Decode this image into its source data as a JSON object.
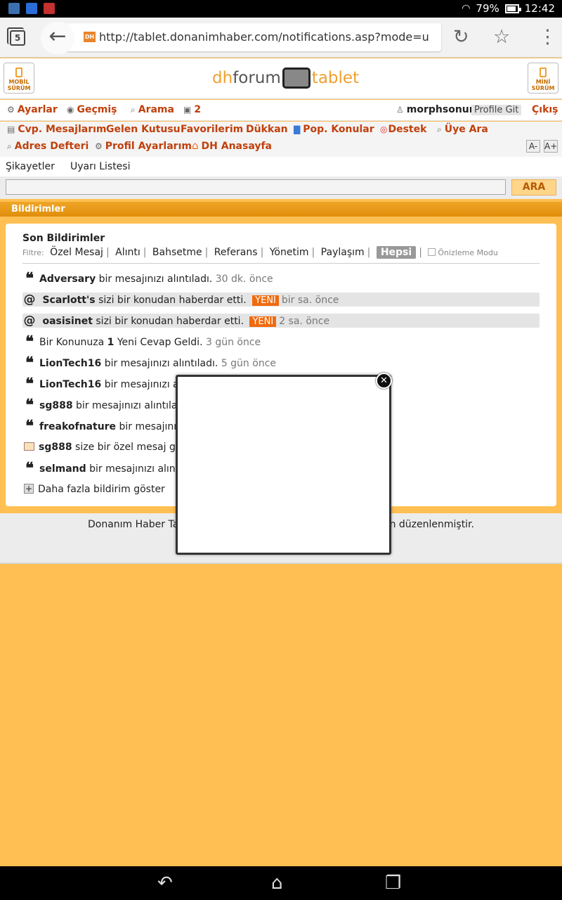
{
  "status_bar": {
    "battery": "79%",
    "time": "12:42"
  },
  "browser": {
    "tab_count": "5",
    "favicon": "DH",
    "url": "http://tablet.donanimhaber.com/notifications.asp?mode=u"
  },
  "site_header": {
    "mobile_btn": "MOBİL SÜRÜM",
    "mini_btn": "MİNİ SÜRÜM",
    "logo_dh": "dh",
    "logo_forum": "forum",
    "logo_tablet": "tablet"
  },
  "nav": {
    "row1": {
      "settings": "Ayarlar",
      "history": "Geçmiş",
      "search": "Arama",
      "messages_count": "2",
      "username": "morphsonur",
      "profile": "Profile Git",
      "logout": "Çıkış"
    },
    "row2": [
      "Cvp. Mesajlarım",
      "Gelen Kutusu",
      "Favorilerim",
      "Dükkan",
      "Pop. Konular",
      "Destek",
      "Üye Ara"
    ],
    "row3": [
      "Adres Defteri",
      "Profil Ayarlarım",
      "DH Anasayfa"
    ],
    "font_small": "A-",
    "font_large": "A+",
    "row4": [
      "Şikayetler",
      "Uyarı Listesi"
    ]
  },
  "search": {
    "value": "",
    "button": "ARA"
  },
  "section_title": "Bildirimler",
  "panel": {
    "title": "Son Bildirimler",
    "filter_label": "Filtre:",
    "filters": [
      "Özel Mesaj",
      "Alıntı",
      "Bahsetme",
      "Referans",
      "Yönetim",
      "Paylaşım"
    ],
    "active_filter": "Hepsi",
    "preview_mode": "Önizleme Modu",
    "notifications": [
      {
        "user": "Adversary",
        "text": "bir mesajınızı alıntıladı.",
        "time": "30 dk. önce"
      },
      {
        "user": "Scarlott's",
        "text": "sizi bir konudan haberdar etti.",
        "new": "YENİ",
        "time": "bir sa. önce"
      },
      {
        "user": "oasisinet",
        "text": "sizi bir konudan haberdar etti.",
        "new": "YENİ",
        "time": "2 sa. önce"
      },
      {
        "pre": "Bir Konunuza",
        "count": "1",
        "text": "Yeni Cevap Geldi.",
        "time": "3 gün önce"
      },
      {
        "user": "LionTech16",
        "text": "bir mesajınızı alıntıladı.",
        "time": "5 gün önce"
      },
      {
        "user": "LionTech16",
        "text": "bir mesajınızı alın"
      },
      {
        "user": "sg888",
        "text": "bir mesajınızı alıntıladı"
      },
      {
        "user": "freakofnature",
        "text": "bir mesajınızı a"
      },
      {
        "user": "sg888",
        "text": "size bir özel mesaj gön"
      },
      {
        "user": "selmand",
        "text": "bir mesajınızı alıntıla"
      }
    ],
    "more": "Daha fazla bildirim göster"
  },
  "footer": {
    "text_left": "Donanım Haber Ta",
    "text_right": "in düzenlenmiştir."
  },
  "popup": {
    "close": "✕"
  }
}
